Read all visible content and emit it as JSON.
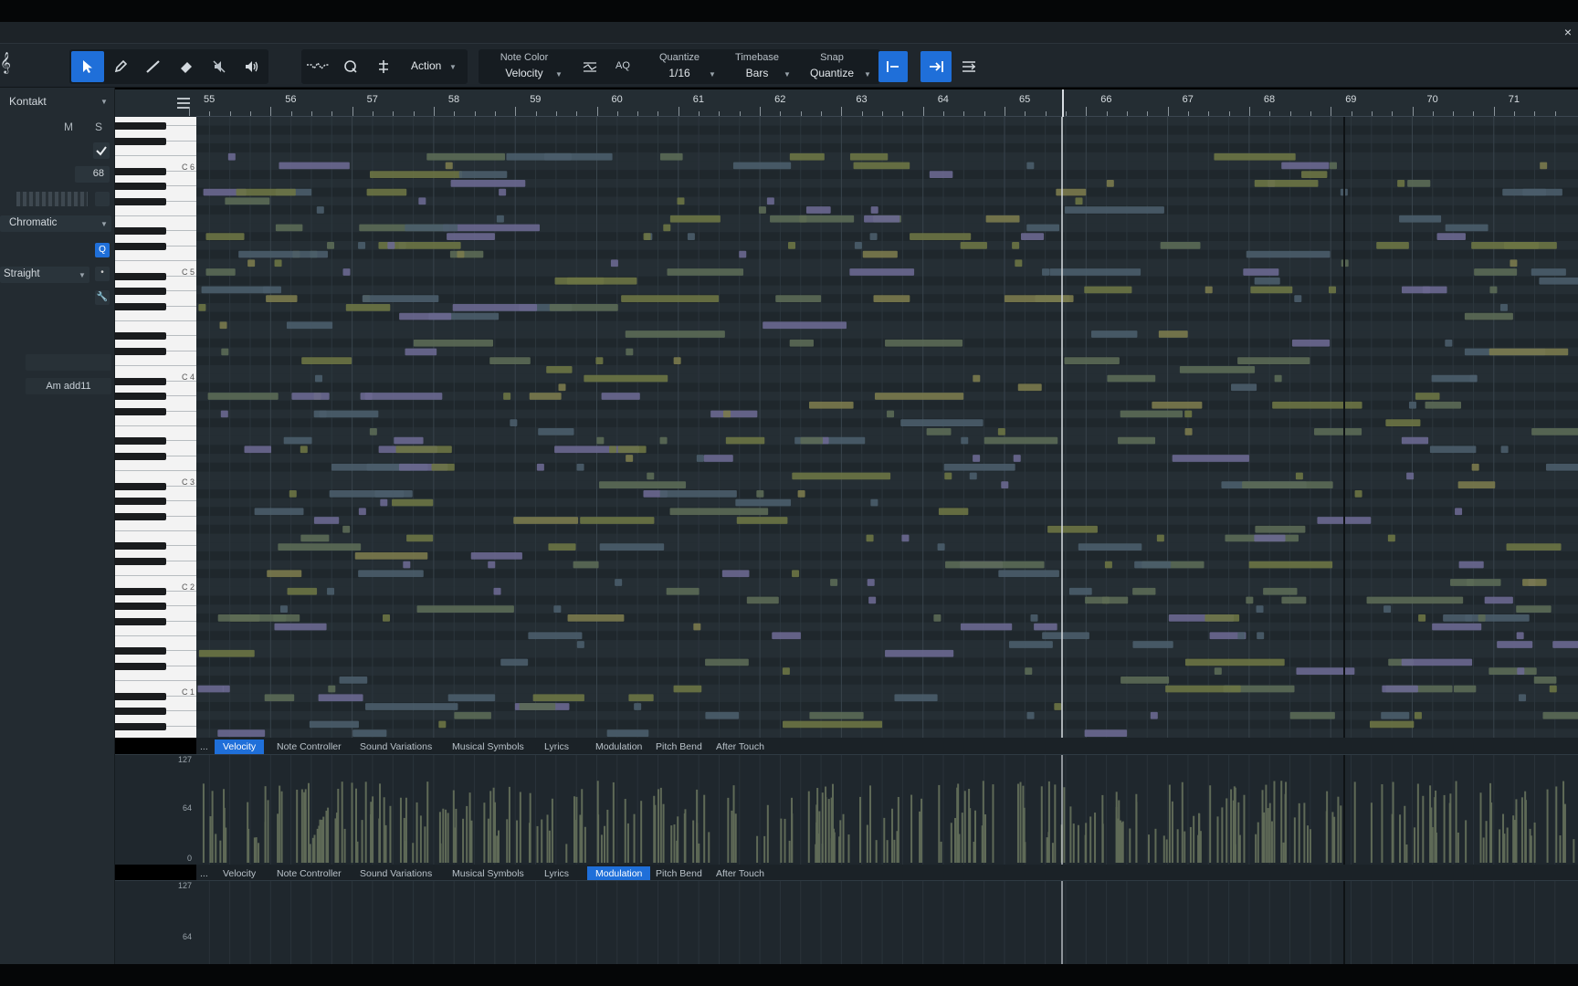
{
  "window": {
    "close_glyph": "×"
  },
  "toolbar": {
    "tools": [
      "arrow-tool",
      "pencil-tool",
      "paint-tool",
      "eraser-tool",
      "mute-tool",
      "listen-tool"
    ],
    "action_label": "Action",
    "note_color_label": "Note Color",
    "note_color_value": "Velocity",
    "aq_label": "AQ",
    "quantize_label": "Quantize",
    "quantize_value": "1/16",
    "timebase_label": "Timebase",
    "timebase_value": "Bars",
    "snap_label": "Snap",
    "snap_value": "Quantize"
  },
  "left_panel": {
    "instrument": "Kontakt",
    "mute_label": "M",
    "solo_label": "S",
    "value_68": "68",
    "scale": "Chromatic",
    "groove": "Straight",
    "chord": "Am add11"
  },
  "keyboard": {
    "c_labels": [
      "C 6",
      "C 5",
      "C 4",
      "C 3",
      "C 2",
      "C 1"
    ]
  },
  "ruler": {
    "bars": [
      "55",
      "56",
      "57",
      "58",
      "59",
      "60",
      "61",
      "62",
      "63",
      "64",
      "65",
      "66",
      "67",
      "68",
      "69",
      "70",
      "71"
    ]
  },
  "controller_tabs": [
    "Velocity",
    "Note Controller",
    "Sound Variations",
    "Musical Symbols",
    "Lyrics",
    "Modulation",
    "Pitch Bend",
    "After Touch"
  ],
  "controller_1": {
    "active_tab": "Velocity",
    "more": "...",
    "axis": [
      "127",
      "64",
      "0"
    ]
  },
  "controller_2": {
    "active_tab": "Modulation",
    "more": "...",
    "axis": [
      "127",
      "64"
    ]
  },
  "colors": {
    "accent": "#1f6fd9",
    "note_olive": "#6c7444",
    "note_slate": "#4a5d6a",
    "note_violet": "#6a6890",
    "playhead": "#d8dde2"
  }
}
